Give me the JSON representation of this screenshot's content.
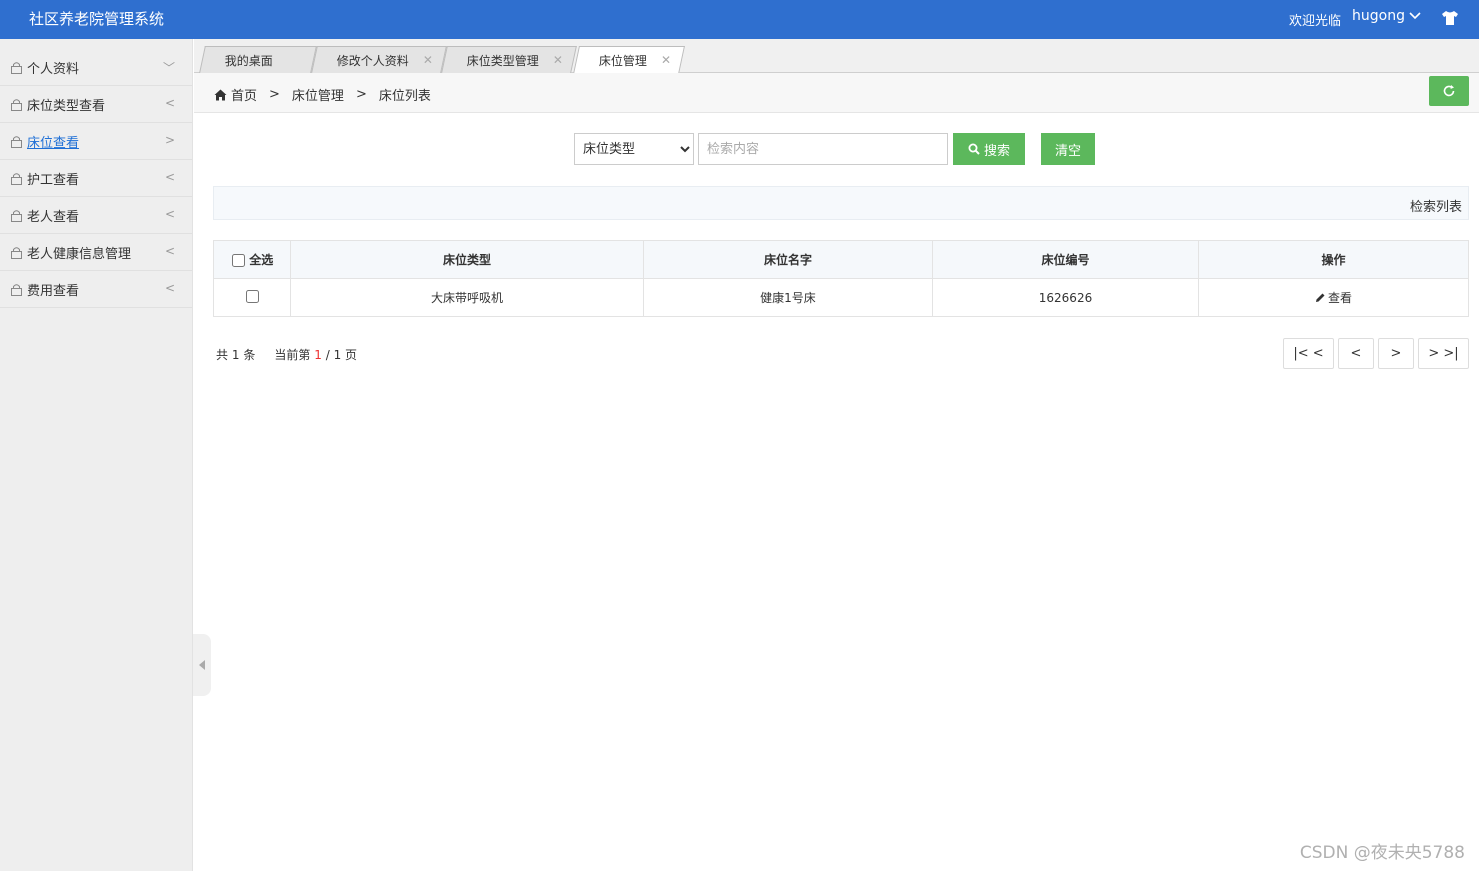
{
  "header": {
    "title": "社区养老院管理系统",
    "welcome": "欢迎光临",
    "username": "hugong"
  },
  "sidebar": {
    "items": [
      {
        "label": "个人资料",
        "arrow": "﹀"
      },
      {
        "label": "床位类型查看",
        "arrow": "<"
      },
      {
        "label": "床位查看",
        "arrow": ">"
      },
      {
        "label": "护工查看",
        "arrow": "<"
      },
      {
        "label": "老人查看",
        "arrow": "<"
      },
      {
        "label": "老人健康信息管理",
        "arrow": "<"
      },
      {
        "label": "费用查看",
        "arrow": "<"
      }
    ],
    "active_index": 2
  },
  "tabs": [
    {
      "label": "我的桌面"
    },
    {
      "label": "修改个人资料"
    },
    {
      "label": "床位类型管理"
    },
    {
      "label": "床位管理"
    }
  ],
  "breadcrumb": {
    "home": "首页",
    "level1": "床位管理",
    "level2": "床位列表",
    "sep": ">"
  },
  "search": {
    "select_value": "床位类型",
    "placeholder": "检索内容",
    "search_label": "搜索",
    "clear_label": "清空"
  },
  "list_banner": "检索列表",
  "table": {
    "select_all": "全选",
    "columns": [
      "床位类型",
      "床位名字",
      "床位编号",
      "操作"
    ],
    "rows": [
      {
        "type": "大床带呼吸机",
        "name": "健康1号床",
        "number": "1626626",
        "action": "查看"
      }
    ]
  },
  "pager": {
    "total_prefix": "共",
    "total": "1",
    "total_suffix": "条",
    "current_prefix": "当前第",
    "current": "1",
    "pages": "/ 1 页",
    "first": "|< <",
    "prev": "<",
    "next": ">",
    "last": "> >|"
  },
  "watermark": "CSDN @夜未央5788",
  "colors": {
    "header_bg": "#2f6fcf",
    "button_green": "#5cb85c",
    "active_link": "#1e6fd6"
  }
}
